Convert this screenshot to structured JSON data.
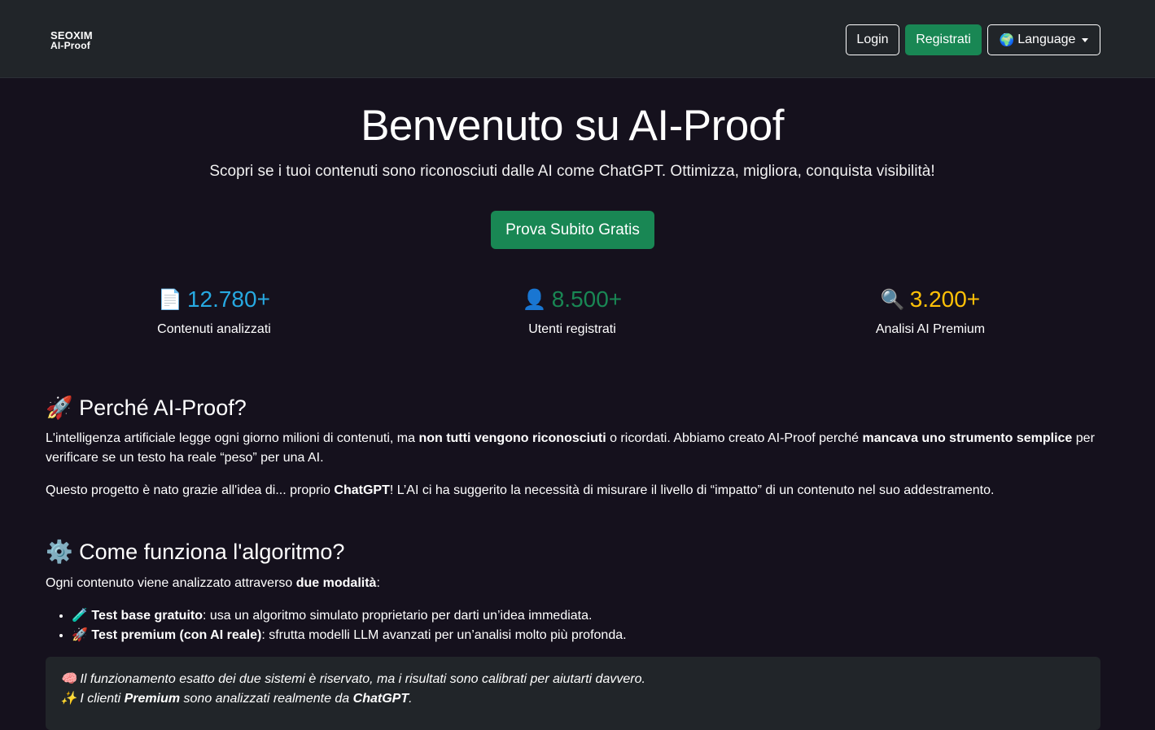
{
  "nav": {
    "brand_line1": "SEOXIM",
    "brand_line2": "AI-Proof",
    "login_label": "Login",
    "register_label": "Registrati",
    "language_label": "Language",
    "language_icon": "🌍"
  },
  "hero": {
    "title": "Benvenuto su AI-Proof",
    "subtitle": "Scopri se i tuoi contenuti sono riconosciuti dalle AI come ChatGPT. Ottimizza, migliora, conquista visibilità!",
    "cta_label": "Prova Subito Gratis"
  },
  "stats": [
    {
      "emoji": "📄",
      "value": "12.780+",
      "label": "Contenuti analizzati",
      "color": "#27a9e1"
    },
    {
      "emoji": "👤",
      "value": "8.500+",
      "label": "Utenti registrati",
      "color": "#198754"
    },
    {
      "emoji": "🔍",
      "value": "3.200+",
      "label": "Analisi AI Premium",
      "color": "#ffc107"
    }
  ],
  "why": {
    "heading": "🚀 Perché AI-Proof?",
    "p1_a": "L'intelligenza artificiale legge ogni giorno milioni di contenuti, ma ",
    "p1_b": "non tutti vengono riconosciuti",
    "p1_c": " o ricordati. Abbiamo creato AI-Proof perché ",
    "p1_d": "mancava uno strumento semplice",
    "p1_e": " per verificare se un testo ha reale “peso” per una AI.",
    "p2_a": "Questo progetto è nato grazie all'idea di... proprio ",
    "p2_b": "ChatGPT",
    "p2_c": "! L’AI ci ha suggerito la necessità di misurare il livello di “impatto” di un contenuto nel suo addestramento."
  },
  "how": {
    "heading": "⚙️ Come funziona l'algoritmo?",
    "intro_a": "Ogni contenuto viene analizzato attraverso ",
    "intro_b": "due modalità",
    "intro_c": ":",
    "items": [
      {
        "emoji": "🧪",
        "bold": "Test base gratuito",
        "rest": ": usa un algoritmo simulato proprietario per darti un’idea immediata."
      },
      {
        "emoji": "🚀",
        "bold": "Test premium (con AI reale)",
        "rest": ": sfrutta modelli LLM avanzati per un’analisi molto più profonda."
      }
    ],
    "note_line1": "🧠 Il funzionamento esatto dei due sistemi è riservato, ma i risultati sono calibrati per aiutarti davvero.",
    "note_line2_a": "✨ I clienti ",
    "note_line2_b": "Premium",
    "note_line2_c": " sono analizzati realmente da ",
    "note_line2_d": "ChatGPT",
    "note_line2_e": "."
  }
}
